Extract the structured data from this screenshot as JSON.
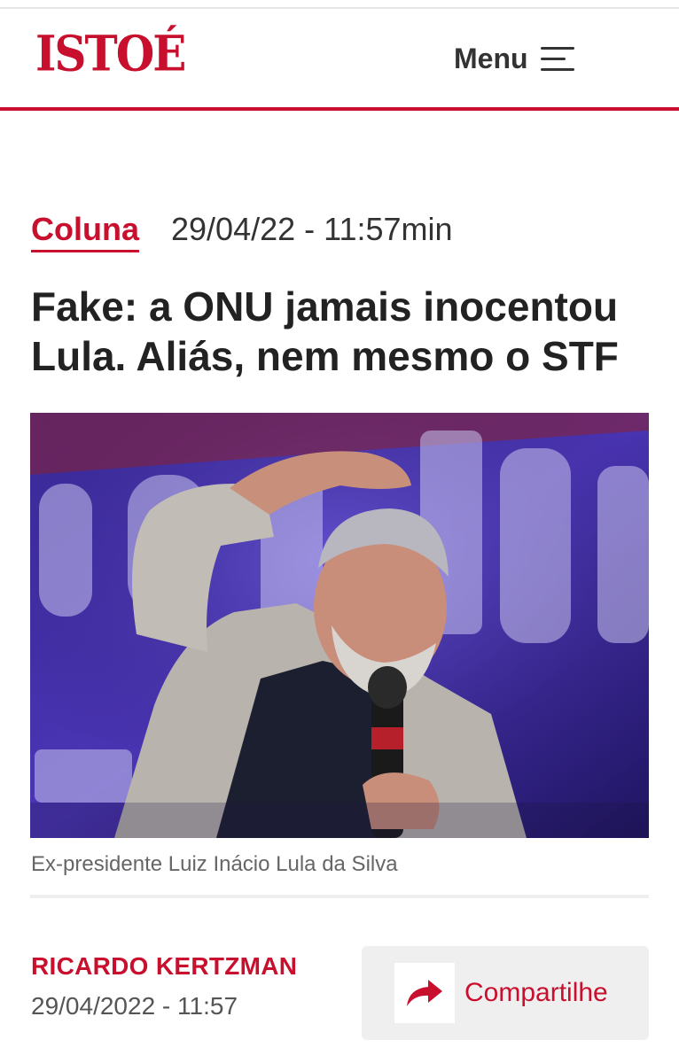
{
  "header": {
    "logo_text": "ISTOÉ",
    "menu_label": "Menu"
  },
  "article": {
    "category": "Coluna",
    "datetime": "29/04/22 - 11:57min",
    "headline": "Fake: a ONU jamais inocentou Lula. Aliás, nem mesmo o STF",
    "image_caption": "Ex-presidente Luiz Inácio Lula da Silva",
    "author": "RICARDO KERTZMAN",
    "published": "29/04/2022 - 11:57",
    "share_label": "Compartilhe"
  },
  "colors": {
    "brand": "#c8102e",
    "text": "#222222",
    "muted": "#666666",
    "share_bg": "#efefef"
  },
  "icons": {
    "menu": "hamburger-icon",
    "share": "share-arrow-icon"
  }
}
